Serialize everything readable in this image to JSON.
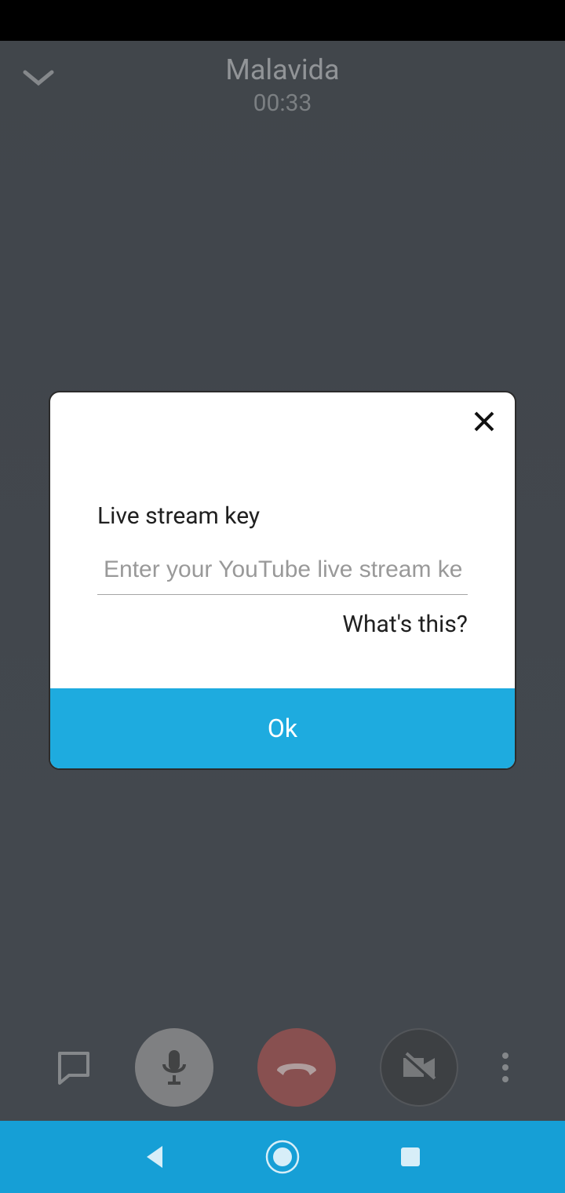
{
  "header": {
    "contact_name": "Malavida",
    "call_timer": "00:33"
  },
  "modal": {
    "label": "Live stream key",
    "placeholder": "Enter your YouTube live stream key he",
    "help_link": "What's this?",
    "ok_label": "Ok"
  },
  "icons": {
    "collapse": "chevron-down",
    "chat": "message",
    "mic": "microphone",
    "hangup": "phone-hangup",
    "video": "video-off",
    "more": "more-vertical",
    "close": "close",
    "nav_back": "back",
    "nav_home": "home-circle",
    "nav_recent": "square"
  },
  "colors": {
    "accent": "#1eabdf",
    "hangup": "#bd6f6f",
    "mic_bg": "#b1b2b4"
  }
}
